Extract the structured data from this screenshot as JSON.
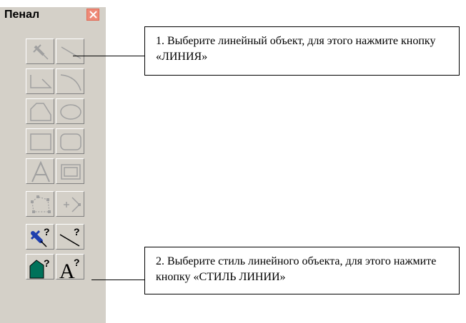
{
  "panel": {
    "title": "Пенал",
    "close_icon": "close-x-icon",
    "tools": [
      {
        "name": "point-tool-button",
        "icon": "pushpin-icon",
        "enabled": false
      },
      {
        "name": "line-tool-button",
        "icon": "line-icon",
        "enabled": false
      },
      {
        "name": "polyline-tool-button",
        "icon": "polyline-icon",
        "enabled": false
      },
      {
        "name": "arc-tool-button",
        "icon": "arc-icon",
        "enabled": false
      },
      {
        "name": "polygon-tool-button",
        "icon": "polygon-icon",
        "enabled": false
      },
      {
        "name": "ellipse-tool-button",
        "icon": "ellipse-icon",
        "enabled": false
      },
      {
        "name": "rectangle-tool-button",
        "icon": "rectangle-icon",
        "enabled": false
      },
      {
        "name": "rounded-rectangle-tool-button",
        "icon": "rounded-rectangle-icon",
        "enabled": false
      },
      {
        "name": "text-tool-button",
        "icon": "text-A-icon",
        "enabled": false
      },
      {
        "name": "frame-tool-button",
        "icon": "frame-icon",
        "enabled": false
      },
      {
        "name": "reshape-tool-button",
        "icon": "reshape-nodes-icon",
        "enabled": false
      },
      {
        "name": "add-node-tool-button",
        "icon": "add-node-icon",
        "enabled": false
      },
      {
        "name": "symbol-style-button",
        "icon": "pushpin-question-icon",
        "enabled": true
      },
      {
        "name": "line-style-button",
        "icon": "line-question-icon",
        "enabled": true
      },
      {
        "name": "region-style-button",
        "icon": "region-question-icon",
        "enabled": true
      },
      {
        "name": "text-style-button",
        "icon": "text-question-icon",
        "enabled": true
      }
    ]
  },
  "callouts": {
    "first": "1. Выберите линейный объект, для этого нажмите кнопку «ЛИНИЯ»",
    "second": "2. Выберите стиль линейного объекта, для этого нажмите кнопку «СТИЛЬ  ЛИНИИ»"
  },
  "colors": {
    "panel_bg": "#d4d0c8",
    "disabled_icon": "#a0a0a0",
    "pin_blue": "#1f3fae",
    "region_teal": "#00725a",
    "close_red": "#ee8a78"
  }
}
